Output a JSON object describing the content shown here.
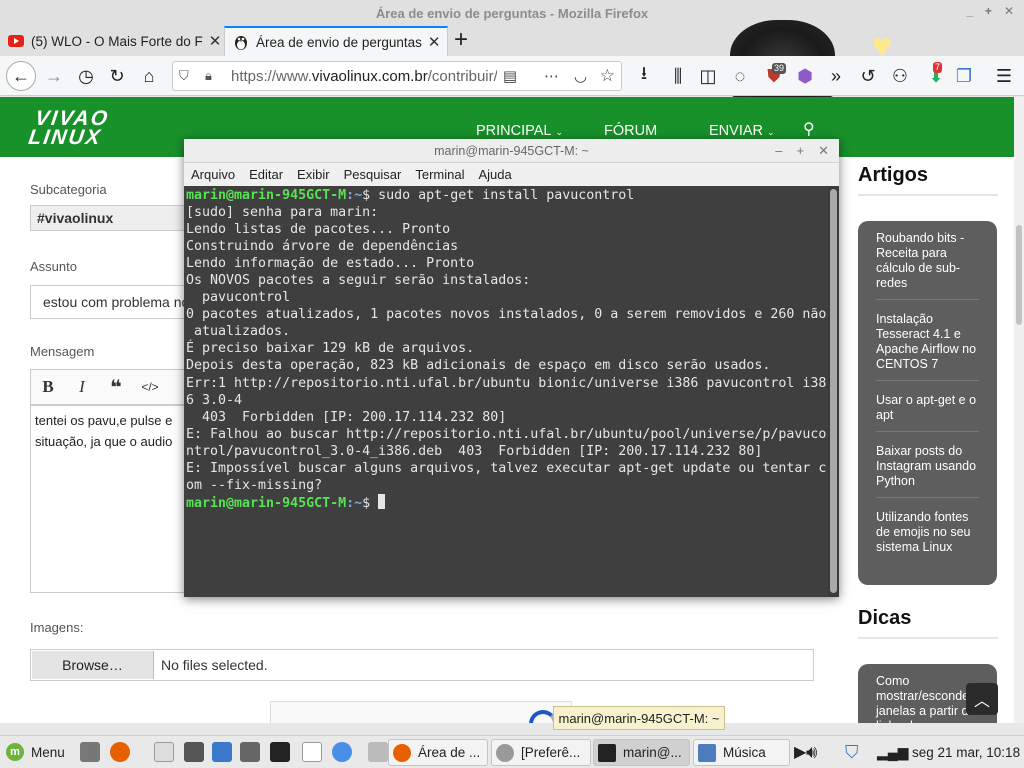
{
  "window": {
    "title": "Área de envio de perguntas - Mozilla Firefox"
  },
  "tabs": [
    {
      "label": "(5) WLO - O Mais Forte do F",
      "icon": "youtube-icon"
    },
    {
      "label": "Área de envio de perguntas",
      "icon": "tux-icon"
    }
  ],
  "navbar": {
    "url_prefix": "https://www.",
    "url_domain": "vivaolinux.com.br",
    "url_rest": "/contribuir/",
    "badge_count": "39",
    "badge2": "7"
  },
  "site": {
    "logo_line1": "VIVAO",
    "logo_line2": "LINUX",
    "menu": [
      "PRINCIPAL",
      "FÓRUM",
      "ENVIAR"
    ],
    "form": {
      "subcat_label": "Subcategoria",
      "subcat_value": "#vivaolinux",
      "assunto_label": "Assunto",
      "assunto_value": "estou com problema no",
      "mensagem_label": "Mensagem",
      "mensagem_line1": "tentei os pavu,e pulse e",
      "mensagem_line2": "situação, ja que o audio",
      "imagens_label": "Imagens:",
      "browse_label": "Browse…",
      "no_files": "No files selected."
    },
    "sidebar": {
      "artigos_title": "Artigos",
      "artigos": [
        "Roubando bits - Receita para cálculo de sub-redes",
        "Instalação Tesseract 4.1 e Apache Airflow no CENTOS 7",
        "Usar o apt-get e o apt",
        "Baixar posts do Instagram usando Python",
        "Utilizando fontes de emojis no seu sistema Linux"
      ],
      "dicas_title": "Dicas",
      "dicas": [
        "Como mostrar/esconder janelas a partir da linha de"
      ]
    }
  },
  "terminal": {
    "title": "marin@marin-945GCT-M: ~",
    "menu": [
      "Arquivo",
      "Editar",
      "Exibir",
      "Pesquisar",
      "Terminal",
      "Ajuda"
    ],
    "prompt_user": "marin@marin-945GCT-M",
    "prompt_path": ":~",
    "prompt_sign": "$ ",
    "command": "sudo apt-get install pavucontrol",
    "output": [
      "[sudo] senha para marin:",
      "Lendo listas de pacotes... Pronto",
      "Construindo árvore de dependências",
      "Lendo informação de estado... Pronto",
      "Os NOVOS pacotes a seguir serão instalados:",
      "  pavucontrol",
      "0 pacotes atualizados, 1 pacotes novos instalados, 0 a serem removidos e 260 não",
      " atualizados.",
      "É preciso baixar 129 kB de arquivos.",
      "Depois desta operação, 823 kB adicionais de espaço em disco serão usados.",
      "Err:1 http://repositorio.nti.ufal.br/ubuntu bionic/universe i386 pavucontrol i38",
      "6 3.0-4",
      "  403  Forbidden [IP: 200.17.114.232 80]",
      "E: Falhou ao buscar http://repositorio.nti.ufal.br/ubuntu/pool/universe/p/pavuco",
      "ntrol/pavucontrol_3.0-4_i386.deb  403  Forbidden [IP: 200.17.114.232 80]",
      "E: Impossível buscar alguns arquivos, talvez executar apt-get update ou tentar c",
      "om --fix-missing?"
    ]
  },
  "tooltip": "marin@marin-945GCT-M: ~",
  "taskbar": {
    "menu_label": "Menu",
    "tasks": [
      {
        "label": "Área de ...",
        "icon": "firefox-icon"
      },
      {
        "label": "[Preferê...",
        "icon": "preferences-icon"
      },
      {
        "label": "marin@...",
        "icon": "terminal-icon"
      },
      {
        "label": "Música",
        "icon": "music-icon"
      }
    ],
    "clock": "seg 21 mar, 10:18"
  }
}
